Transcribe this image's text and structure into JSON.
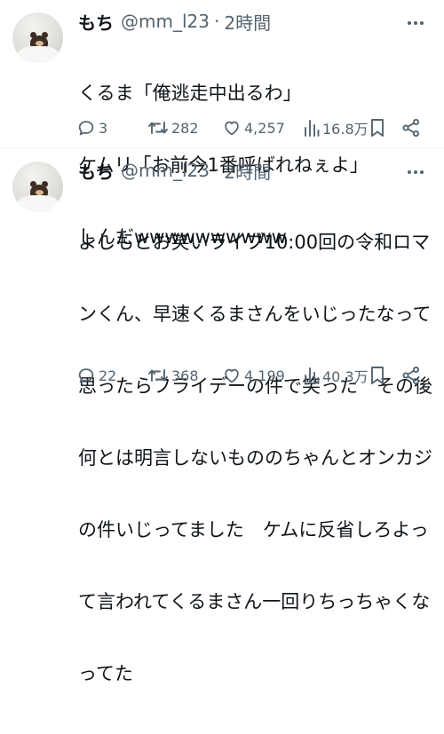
{
  "tweets": [
    {
      "display_name": "もち",
      "handle": "@mm_l23",
      "separator": "·",
      "timestamp": "2時間",
      "text_lines": [
        "くるま「俺逃走中出るわ」",
        "ケムリ「お前今1番呼ばれねぇよ」",
        "しんだwwwwwwwwww"
      ],
      "replies": "3",
      "retweets": "282",
      "likes": "4,257",
      "views": "16.8万"
    },
    {
      "display_name": "もち",
      "handle": "@mm_l23",
      "separator": "·",
      "timestamp": "2時間",
      "text_lines": [
        "よしもとお笑いライブ10:00回の令和ロマ",
        "ンくん、早速くるまさんをいじったなって",
        "思ったらフライデーの件で笑った　その後",
        "何とは明言しないもののちゃんとオンカジ",
        "の件いじってました　ケムに反省しろよっ",
        "て言われてくるまさん一回りちっちゃくな",
        "ってた"
      ],
      "replies": "22",
      "retweets": "368",
      "likes": "4,199",
      "views": "40.3万"
    }
  ],
  "icons": {
    "avatar": "bear-plush-avatar",
    "more": "more-horizontal-icon",
    "reply": "reply-bubble-icon",
    "retweet": "retweet-icon",
    "like": "heart-icon",
    "views": "bar-chart-icon",
    "bookmark": "bookmark-icon",
    "share": "share-icon"
  },
  "colors": {
    "text": "#0f1419",
    "muted": "#536471",
    "divider": "#eff3f4"
  }
}
